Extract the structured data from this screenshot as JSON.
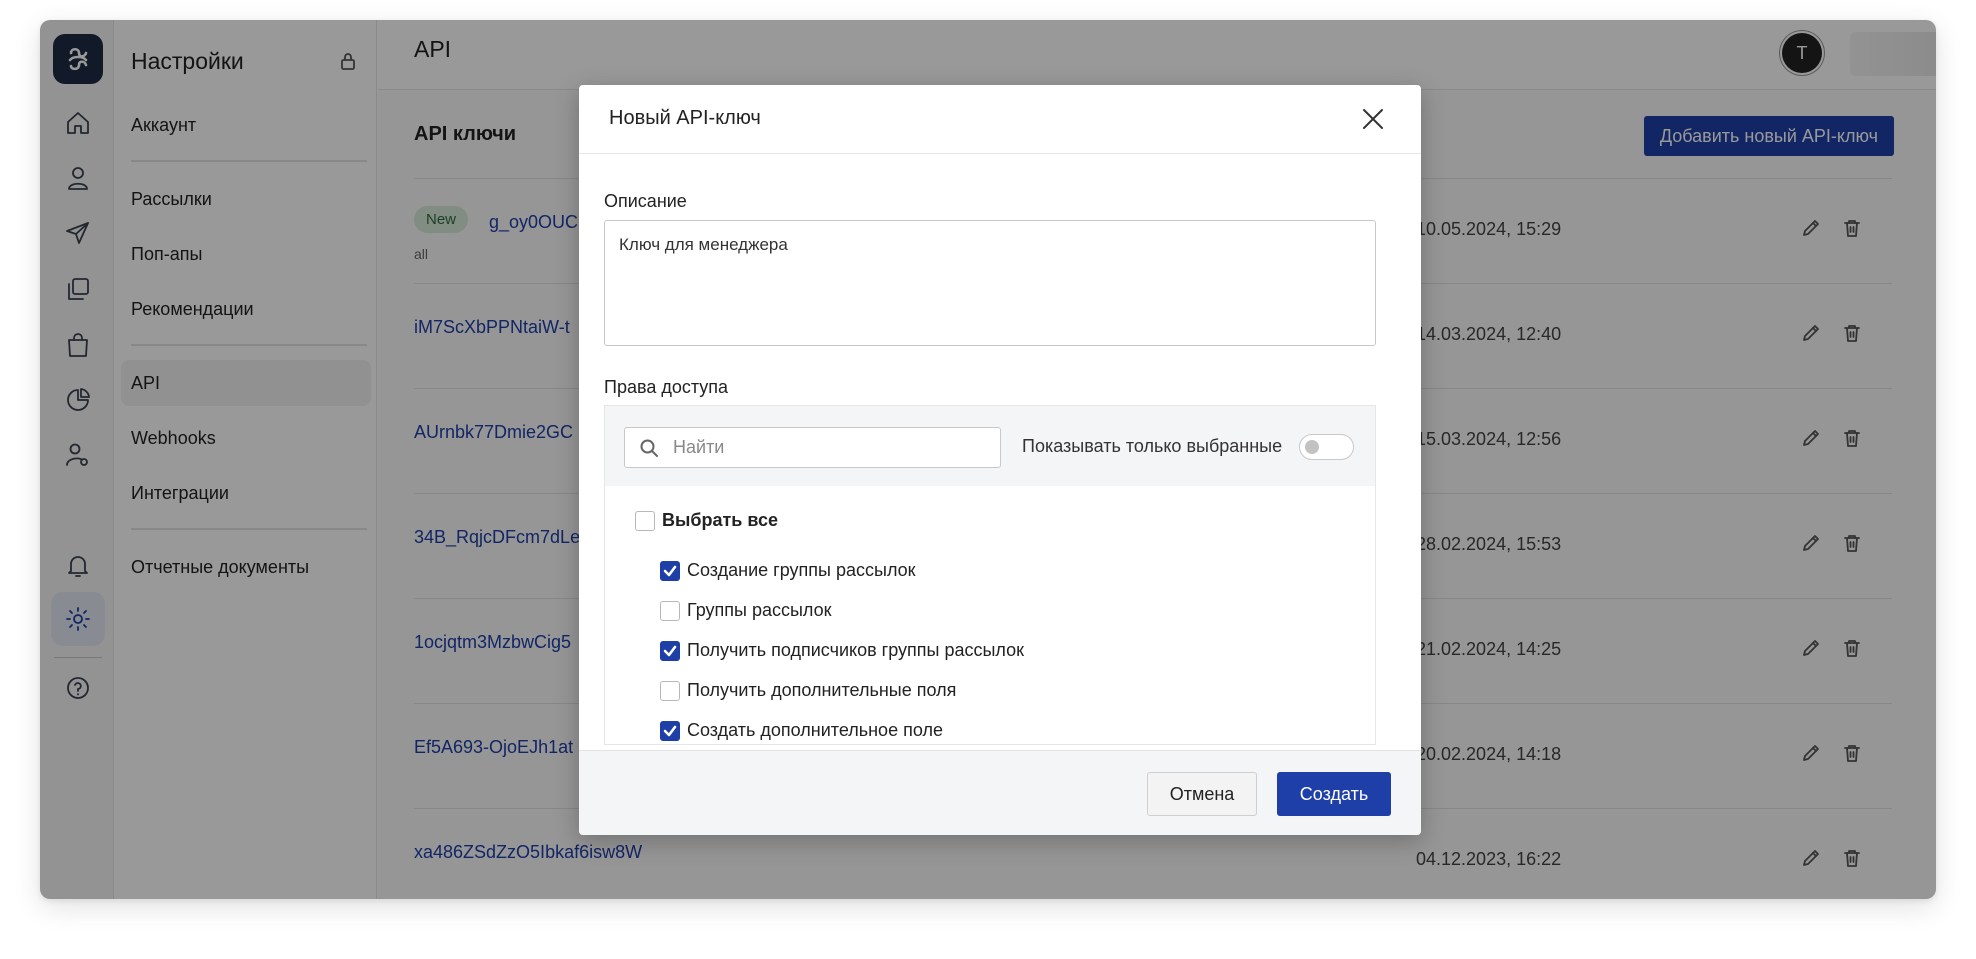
{
  "sidebar": {
    "title": "Настройки",
    "items": [
      {
        "label": "Аккаунт"
      },
      {
        "label": "Рассылки"
      },
      {
        "label": "Поп-апы"
      },
      {
        "label": "Рекомендации"
      },
      {
        "label": "API"
      },
      {
        "label": "Webhooks"
      },
      {
        "label": "Интеграции"
      },
      {
        "label": "Отчетные документы"
      }
    ],
    "active_item": "API"
  },
  "rail": {
    "icons": [
      "logo-icon",
      "home-icon",
      "user-icon",
      "send-icon",
      "copy-icon",
      "shopping-bag-icon",
      "pie-chart-icon",
      "user-settings-icon",
      "bell-icon",
      "gear-icon",
      "help-icon"
    ],
    "active_icon": "gear-icon"
  },
  "header": {
    "title": "API",
    "avatar_letter": "T"
  },
  "main": {
    "section_title": "API ключи",
    "add_button_label": "Добавить новый API-ключ",
    "keys": [
      {
        "badge": "New",
        "name": "g_oy0OUC",
        "scope": "all",
        "date": "10.05.2024, 15:29"
      },
      {
        "name": "iM7ScXbPPNtaiW-t",
        "date": "14.03.2024, 12:40"
      },
      {
        "name": "AUrnbk77Dmie2GC",
        "date": "15.03.2024, 12:56"
      },
      {
        "name": "34B_RqjcDFcm7dLe",
        "date": "28.02.2024, 15:53"
      },
      {
        "name": "1ocjqtm3MzbwCig5",
        "date": "21.02.2024, 14:25"
      },
      {
        "name": "Ef5A693-OjoEJh1at",
        "date": "20.02.2024, 14:18"
      },
      {
        "name": "xa486ZSdZzO5Ibkaf6isw8W",
        "date": "04.12.2023, 16:22"
      }
    ]
  },
  "modal": {
    "title": "Новый API-ключ",
    "description_label": "Описание",
    "description_value": "Ключ для менеджера",
    "permissions_label": "Права доступа",
    "search_placeholder": "Найти",
    "show_selected_label": "Показывать только выбранные",
    "show_selected_on": false,
    "select_all_label": "Выбрать все",
    "select_all_checked": false,
    "permissions": [
      {
        "label": "Создание группы рассылок",
        "checked": true
      },
      {
        "label": "Группы рассылок",
        "checked": false
      },
      {
        "label": "Получить подписчиков группы рассылок",
        "checked": true
      },
      {
        "label": "Получить дополнительные поля",
        "checked": false
      },
      {
        "label": "Создать дополнительное поле",
        "checked": true
      }
    ],
    "cancel_label": "Отмена",
    "create_label": "Создать"
  },
  "colors": {
    "accent": "#1e3ea8",
    "overlay": "rgba(0,0,0,0.40)",
    "badge_bg": "#d7ead9"
  }
}
